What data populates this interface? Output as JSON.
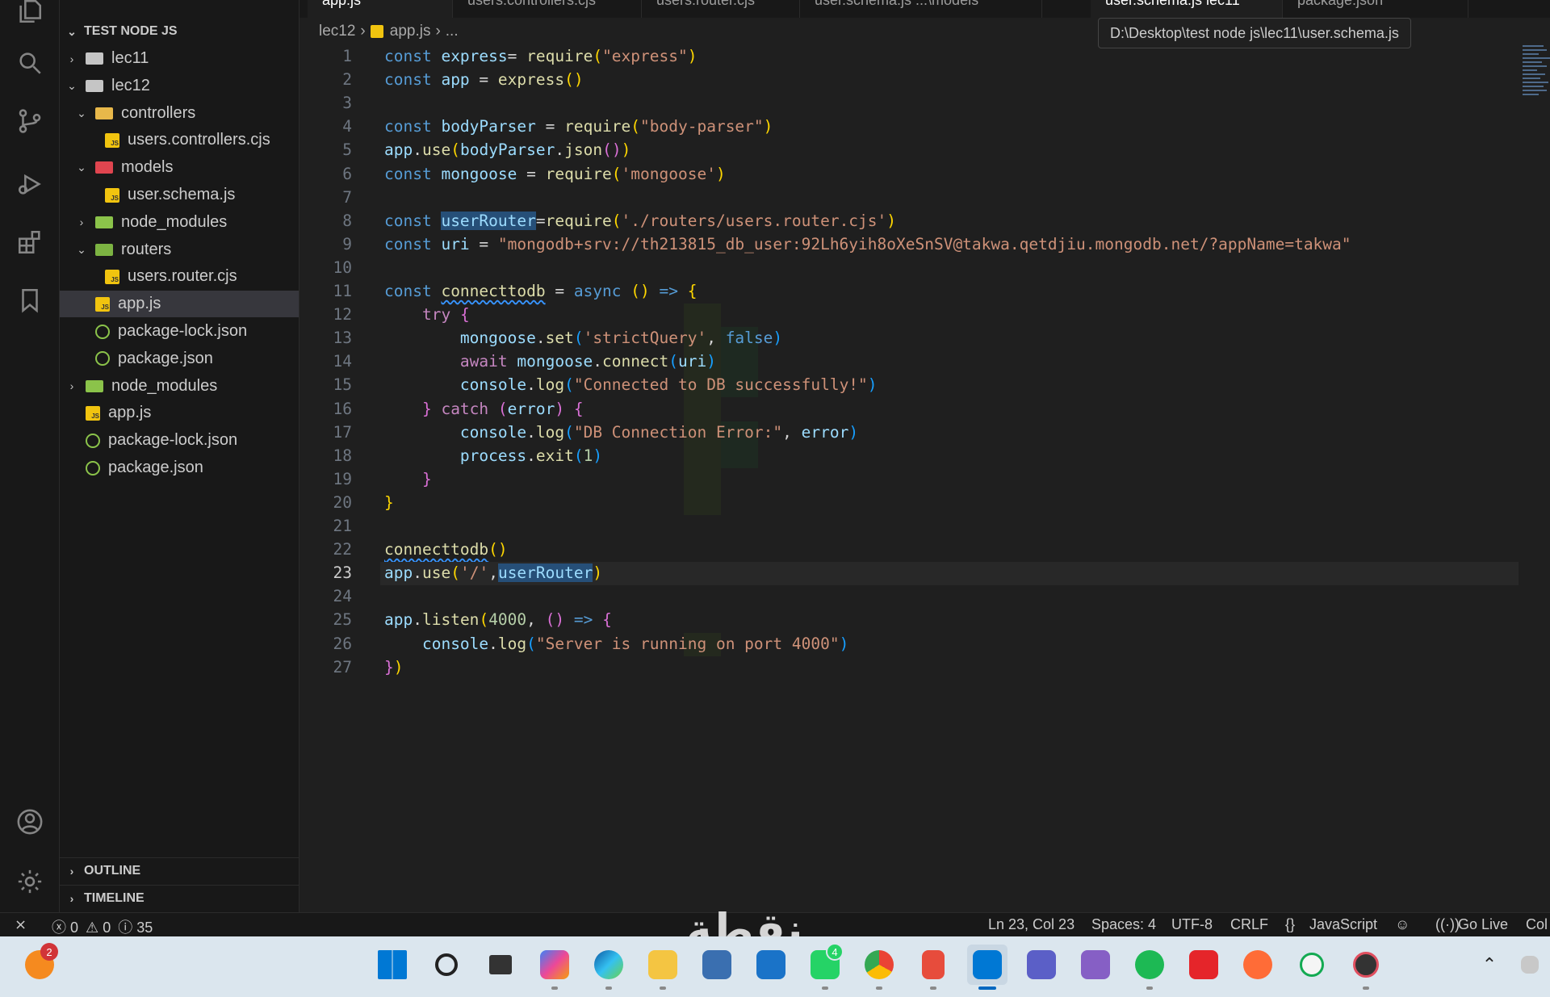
{
  "sidebar": {
    "root_label": "TEST NODE JS",
    "tree": [
      {
        "label": "lec11",
        "indent": 1,
        "chevron": "›",
        "icon": "folder"
      },
      {
        "label": "lec12",
        "indent": 1,
        "chevron": "⌄",
        "icon": "folder-open"
      },
      {
        "label": "controllers",
        "indent": 2,
        "chevron": "⌄",
        "icon": "folder-ctrl"
      },
      {
        "label": "users.controllers.cjs",
        "indent": 3,
        "chevron": "",
        "icon": "js"
      },
      {
        "label": "models",
        "indent": 2,
        "chevron": "⌄",
        "icon": "folder-model"
      },
      {
        "label": "user.schema.js",
        "indent": 3,
        "chevron": "",
        "icon": "js"
      },
      {
        "label": "node_modules",
        "indent": 2,
        "chevron": "›",
        "icon": "folder-node"
      },
      {
        "label": "routers",
        "indent": 2,
        "chevron": "⌄",
        "icon": "folder-route"
      },
      {
        "label": "users.router.cjs",
        "indent": 3,
        "chevron": "",
        "icon": "js"
      },
      {
        "label": "app.js",
        "indent": 2,
        "chevron": "",
        "icon": "js",
        "selected": true
      },
      {
        "label": "package-lock.json",
        "indent": 2,
        "chevron": "",
        "icon": "json"
      },
      {
        "label": "package.json",
        "indent": 2,
        "chevron": "",
        "icon": "json"
      },
      {
        "label": "node_modules",
        "indent": 1,
        "chevron": "›",
        "icon": "folder-node"
      },
      {
        "label": "app.js",
        "indent": 1,
        "chevron": "",
        "icon": "js"
      },
      {
        "label": "package-lock.json",
        "indent": 1,
        "chevron": "",
        "icon": "json"
      },
      {
        "label": "package.json",
        "indent": 1,
        "chevron": "",
        "icon": "json"
      }
    ],
    "outline_label": "OUTLINE",
    "timeline_label": "TIMELINE"
  },
  "tabs": [
    {
      "label": "app.js",
      "active": true
    },
    {
      "label": "users.controllers.cjs"
    },
    {
      "label": "users.router.cjs"
    },
    {
      "label": "user.schema.js  ...\\models"
    },
    {
      "label": "user.schema.js  lec11",
      "active": true
    },
    {
      "label": "package.json"
    }
  ],
  "breadcrumb": {
    "folder": "lec12",
    "file": "app.js",
    "more": "..."
  },
  "tooltip": "D:\\Desktop\\test node js\\lec11\\user.schema.js",
  "editor": {
    "current_line": 23,
    "lines": [
      [
        [
          "kw",
          "const "
        ],
        [
          "var",
          "express"
        ],
        [
          "",
          "= "
        ],
        [
          "fn",
          "require"
        ],
        [
          "br1",
          "("
        ],
        [
          "str",
          "\"express\""
        ],
        [
          "br1",
          ")"
        ]
      ],
      [
        [
          "kw",
          "const "
        ],
        [
          "var",
          "app"
        ],
        [
          "",
          " = "
        ],
        [
          "fn",
          "express"
        ],
        [
          "br1",
          "()"
        ]
      ],
      [],
      [
        [
          "kw",
          "const "
        ],
        [
          "var",
          "bodyParser"
        ],
        [
          "",
          " = "
        ],
        [
          "fn",
          "require"
        ],
        [
          "br1",
          "("
        ],
        [
          "str",
          "\"body-parser\""
        ],
        [
          "br1",
          ")"
        ]
      ],
      [
        [
          "var",
          "app"
        ],
        [
          "",
          "."
        ],
        [
          "fn",
          "use"
        ],
        [
          "br1",
          "("
        ],
        [
          "var",
          "bodyParser"
        ],
        [
          "",
          "."
        ],
        [
          "fn",
          "json"
        ],
        [
          "br2",
          "()"
        ],
        [
          "br1",
          ")"
        ]
      ],
      [
        [
          "kw",
          "const "
        ],
        [
          "var",
          "mongoose"
        ],
        [
          "",
          " = "
        ],
        [
          "fn",
          "require"
        ],
        [
          "br1",
          "("
        ],
        [
          "str",
          "'mongoose'"
        ],
        [
          "br1",
          ")"
        ]
      ],
      [],
      [
        [
          "kw",
          "const "
        ],
        [
          "var sel-hl",
          "userRouter"
        ],
        [
          "",
          "="
        ],
        [
          "fn",
          "require"
        ],
        [
          "br1",
          "("
        ],
        [
          "str",
          "'./routers/users.router.cjs'"
        ],
        [
          "br1",
          ")"
        ]
      ],
      [
        [
          "kw",
          "const "
        ],
        [
          "var",
          "uri"
        ],
        [
          "",
          " = "
        ],
        [
          "str",
          "\"mongodb+srv://th213815_db_user:92Lh6yih8oXeSnSV@takwa.qetdjiu.mongodb.net/?appName=takwa\""
        ]
      ],
      [],
      [
        [
          "kw",
          "const "
        ],
        [
          "fn squig",
          "connecttodb"
        ],
        [
          "",
          " = "
        ],
        [
          "kw",
          "async "
        ],
        [
          "br1",
          "()"
        ],
        [
          "kw",
          " => "
        ],
        [
          "br1",
          "{"
        ]
      ],
      [
        [
          "",
          "    "
        ],
        [
          "kw2",
          "try "
        ],
        [
          "br2",
          "{"
        ]
      ],
      [
        [
          "",
          "        "
        ],
        [
          "var",
          "mongoose"
        ],
        [
          "",
          "."
        ],
        [
          "fn",
          "set"
        ],
        [
          "br3",
          "("
        ],
        [
          "str",
          "'strictQuery'"
        ],
        [
          "",
          ", "
        ],
        [
          "kw",
          "false"
        ],
        [
          "br3",
          ")"
        ]
      ],
      [
        [
          "",
          "        "
        ],
        [
          "kw2",
          "await "
        ],
        [
          "var",
          "mongoose"
        ],
        [
          "",
          "."
        ],
        [
          "fn",
          "connect"
        ],
        [
          "br3",
          "("
        ],
        [
          "var",
          "uri"
        ],
        [
          "br3",
          ")"
        ]
      ],
      [
        [
          "",
          "        "
        ],
        [
          "var",
          "console"
        ],
        [
          "",
          "."
        ],
        [
          "fn",
          "log"
        ],
        [
          "br3",
          "("
        ],
        [
          "str",
          "\"Connected to DB successfully!\""
        ],
        [
          "br3",
          ")"
        ]
      ],
      [
        [
          "",
          "    "
        ],
        [
          "br2",
          "} "
        ],
        [
          "kw2",
          "catch "
        ],
        [
          "br2",
          "("
        ],
        [
          "var",
          "error"
        ],
        [
          "br2",
          ") {"
        ]
      ],
      [
        [
          "",
          "        "
        ],
        [
          "var",
          "console"
        ],
        [
          "",
          "."
        ],
        [
          "fn",
          "log"
        ],
        [
          "br3",
          "("
        ],
        [
          "str",
          "\"DB Connection Error:\""
        ],
        [
          "",
          ", "
        ],
        [
          "var",
          "error"
        ],
        [
          "br3",
          ")"
        ]
      ],
      [
        [
          "",
          "        "
        ],
        [
          "var",
          "process"
        ],
        [
          "",
          "."
        ],
        [
          "fn",
          "exit"
        ],
        [
          "br3",
          "("
        ],
        [
          "num",
          "1"
        ],
        [
          "br3",
          ")"
        ]
      ],
      [
        [
          "",
          "    "
        ],
        [
          "br2",
          "}"
        ]
      ],
      [
        [
          "br1",
          "}"
        ]
      ],
      [],
      [
        [
          "fn squig",
          "connecttodb"
        ],
        [
          "br1",
          "()"
        ]
      ],
      [
        [
          "var",
          "app"
        ],
        [
          "",
          "."
        ],
        [
          "fn",
          "use"
        ],
        [
          "br1",
          "("
        ],
        [
          "str",
          "'/'"
        ],
        [
          "",
          ","
        ],
        [
          "var sel-hl",
          "userRouter"
        ],
        [
          "br1",
          ")"
        ]
      ],
      [],
      [
        [
          "var",
          "app"
        ],
        [
          "",
          "."
        ],
        [
          "fn",
          "listen"
        ],
        [
          "br1",
          "("
        ],
        [
          "num",
          "4000"
        ],
        [
          "",
          ", "
        ],
        [
          "br2",
          "()"
        ],
        [
          "kw",
          " => "
        ],
        [
          "br2",
          "{"
        ]
      ],
      [
        [
          "",
          "    "
        ],
        [
          "var",
          "console"
        ],
        [
          "",
          "."
        ],
        [
          "fn",
          "log"
        ],
        [
          "br3",
          "("
        ],
        [
          "str",
          "\"Server is running on port 4000\""
        ],
        [
          "br3",
          ")"
        ]
      ],
      [
        [
          "br2",
          "}"
        ],
        [
          "br1",
          ")"
        ]
      ]
    ]
  },
  "status": {
    "errors": "0",
    "warnings": "0",
    "info": "35",
    "cursor": "Ln 23, Col 23",
    "spaces": "Spaces: 4",
    "encoding": "UTF-8",
    "eol": "CRLF",
    "language": "JavaScript",
    "golive": "Go Live",
    "cut_label": "Col"
  },
  "taskbar": {
    "notification_count": "2",
    "whatsapp_count": "4",
    "watermark": "نقطة"
  }
}
